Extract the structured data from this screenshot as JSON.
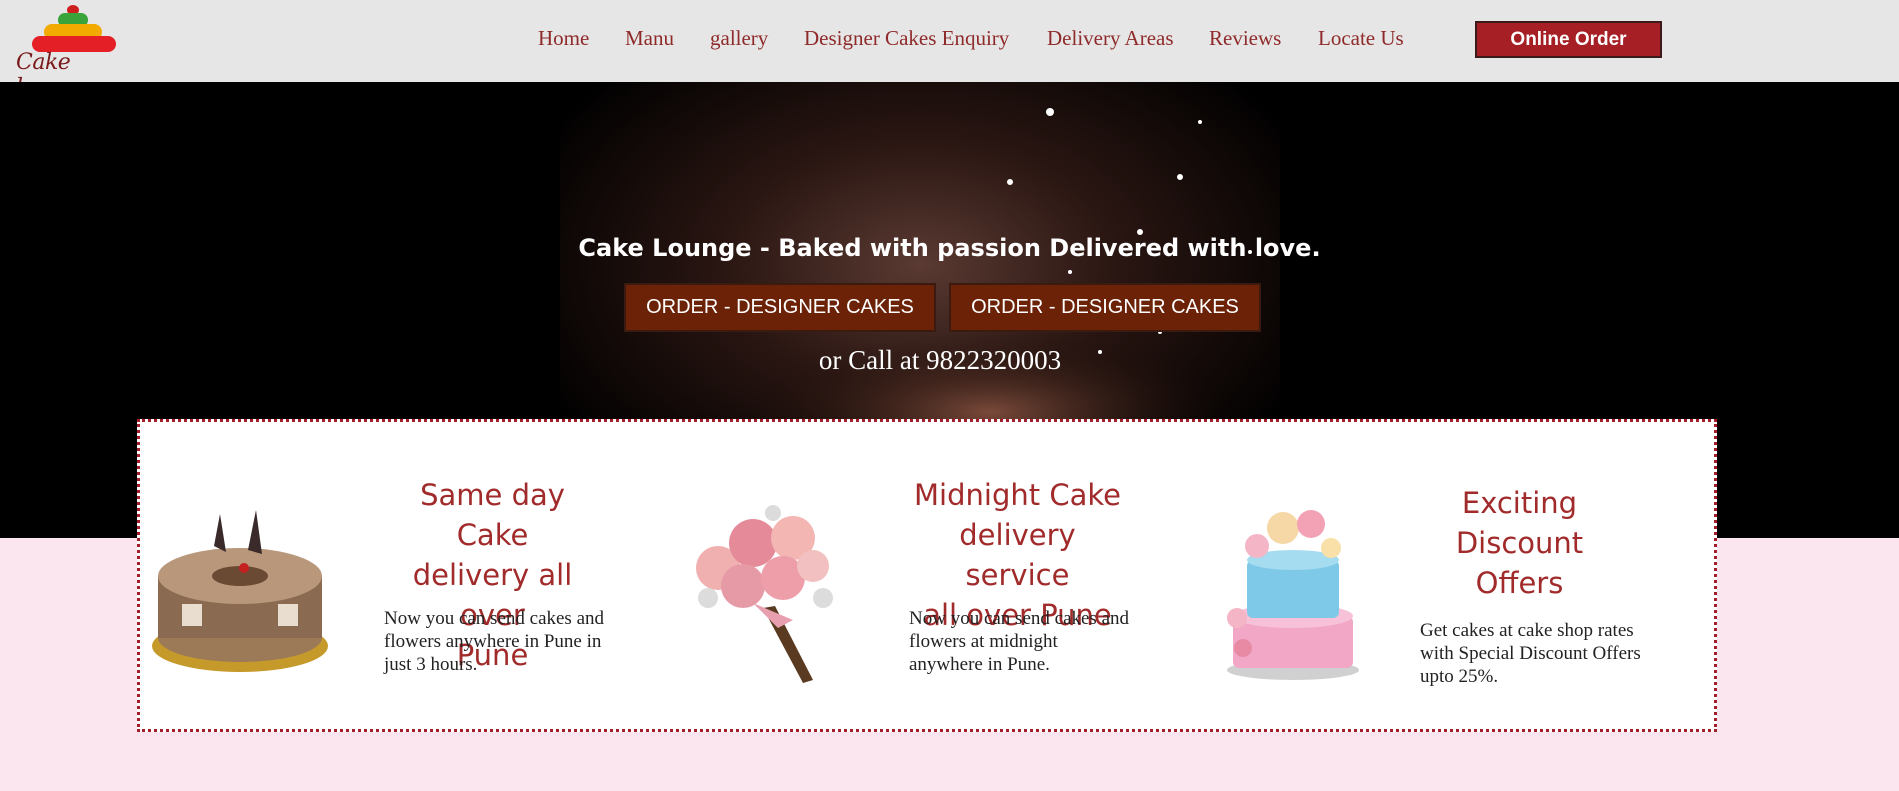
{
  "brand": {
    "name": "Cake lounge"
  },
  "nav": {
    "items": [
      {
        "label": "Home"
      },
      {
        "label": "Manu"
      },
      {
        "label": "gallery"
      },
      {
        "label": "Designer Cakes Enquiry"
      },
      {
        "label": "Delivery Areas"
      },
      {
        "label": "Reviews"
      },
      {
        "label": "Locate Us"
      }
    ],
    "order_button": "Online Order"
  },
  "hero": {
    "tagline": "Cake Lounge - Baked with passion Delivered with love.",
    "buttons": [
      {
        "label": "ORDER - DESIGNER CAKES"
      },
      {
        "label": "ORDER - DESIGNER CAKES"
      }
    ],
    "call_text": "or Call at 9822320003"
  },
  "features": [
    {
      "image_icon": "chocolate-cake-icon",
      "title_lines": [
        "Same day Cake",
        "delivery all over",
        "Pune"
      ],
      "desc_lines": [
        "Now you can send cakes and",
        "flowers anywhere in Pune in",
        "just 3 hours."
      ]
    },
    {
      "image_icon": "rose-bouquet-icon",
      "title_lines": [
        "Midnight Cake",
        "delivery service",
        "all over Pune"
      ],
      "desc_lines": [
        "Now you can send cakes and",
        "flowers at midnight",
        "anywhere in Pune."
      ]
    },
    {
      "image_icon": "tiered-cake-icon",
      "title_lines": [
        "Exciting Discount",
        "Offers"
      ],
      "desc_lines": [
        "Get cakes at cake shop rates",
        "with Special Discount Offers",
        "upto 25%."
      ]
    }
  ],
  "colors": {
    "header_bg": "#e6e6e6",
    "nav_text": "#8f2a2a",
    "online_order_bg": "#a51f25",
    "order_button_bg": "#6b2207",
    "feature_title": "#a12a2a",
    "page_bg": "#fbe5ef"
  }
}
